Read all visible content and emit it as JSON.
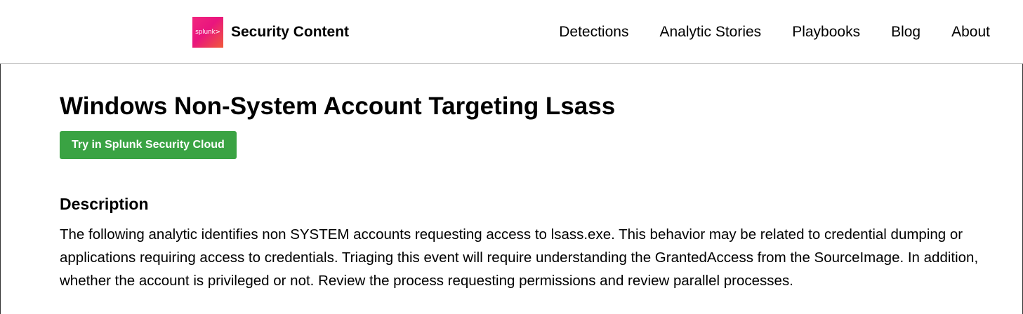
{
  "header": {
    "logo_text": "splunk>",
    "brand": "Security Content",
    "nav": [
      "Detections",
      "Analytic Stories",
      "Playbooks",
      "Blog",
      "About"
    ]
  },
  "main": {
    "title": "Windows Non-System Account Targeting Lsass",
    "cta_label": "Try in Splunk Security Cloud",
    "description_heading": "Description",
    "description_text": "The following analytic identifies non SYSTEM accounts requesting access to lsass.exe. This behavior may be related to credential dumping or applications requiring access to credentials. Triaging this event will require understanding the GrantedAccess from the SourceImage. In addition, whether the account is privileged or not. Review the process requesting permissions and review parallel processes."
  },
  "colors": {
    "cta_green": "#3aa343",
    "logo_pink": "#e9157e",
    "logo_orange": "#f15a3a"
  }
}
